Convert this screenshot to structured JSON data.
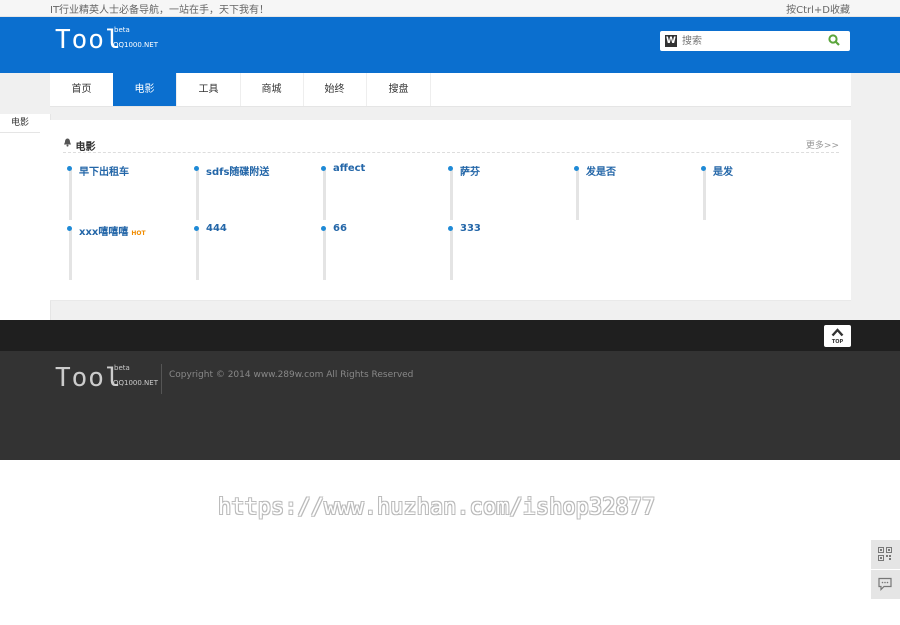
{
  "topbar": {
    "left_text": "IT行业精英人士必备导航，一站在手，天下我有！",
    "right_text": "按Ctrl+D收藏"
  },
  "brand": {
    "word": "Tool",
    "beta": "beta",
    "site": "QQ1000.NET"
  },
  "search": {
    "placeholder": "搜索",
    "engine_icon": "W"
  },
  "nav": {
    "items": [
      "首页",
      "电影",
      "工具",
      "商城",
      "始终",
      "搜盘"
    ],
    "active": "电影"
  },
  "sidebar": {
    "label": "电影"
  },
  "section": {
    "title": "电影",
    "more": "更多>>",
    "links": [
      {
        "text": "早下出租车"
      },
      {
        "text": "sdfs随碟附送"
      },
      {
        "text": "affect"
      },
      {
        "text": "萨芬"
      },
      {
        "text": "发是否"
      },
      {
        "text": "是发"
      },
      {
        "text": "xxx嘻嘻嘻",
        "badge": "HOT"
      },
      {
        "text": "444"
      },
      {
        "text": "66"
      },
      {
        "text": "333"
      }
    ]
  },
  "totop": {
    "label": "TOP"
  },
  "footer": {
    "copyright": "Copyright © 2014 www.289w.com All Rights Reserved"
  },
  "watermark": "https://www.huzhan.com/ishop32877",
  "colors": {
    "brand_blue": "#0b6fcf",
    "link_blue": "#2366a8",
    "footer_bg": "#333333"
  }
}
